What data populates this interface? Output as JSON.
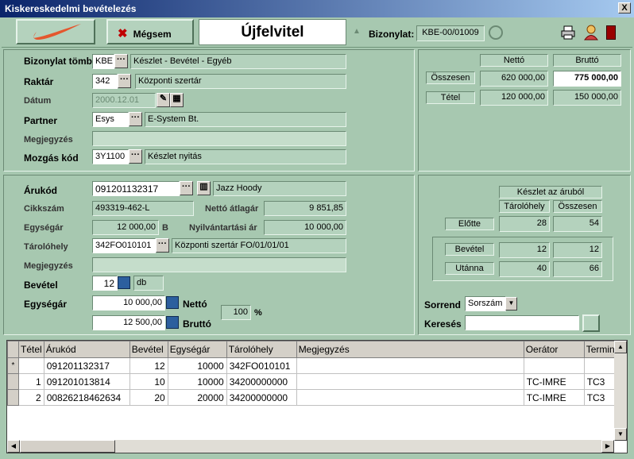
{
  "window": {
    "title": "Kiskereskedelmi bevételezés",
    "close": "X"
  },
  "toolbar": {
    "cancel": "Mégsem",
    "mode": "Újfelvitel",
    "doc_label": "Bizonylat:",
    "doc_value": "KBE-00/01009"
  },
  "form": {
    "bizonylat_tomb_label": "Bizonylat tömb",
    "bizonylat_tomb_code": "KBE",
    "bizonylat_tomb_desc": "Készlet - Bevétel - Egyéb",
    "raktar_label": "Raktár",
    "raktar_code": "342",
    "raktar_desc": "Központi szertár",
    "datum_label": "Dátum",
    "datum_value": "2000.12.01",
    "partner_label": "Partner",
    "partner_code": "Esys",
    "partner_desc": "E-System Bt.",
    "megjegyzes_label": "Megjegyzés",
    "mozgas_label": "Mozgás kód",
    "mozgas_code": "3Y1100",
    "mozgas_desc": "Készlet nyitás"
  },
  "totals": {
    "netto": "Nettó",
    "brutto": "Bruttó",
    "osszesen": "Összesen",
    "osszesen_netto": "620 000,00",
    "osszesen_brutto": "775 000,00",
    "tetel": "Tétel",
    "tetel_netto": "120 000,00",
    "tetel_brutto": "150 000,00"
  },
  "item": {
    "arukod_label": "Árukód",
    "arukod_value": "091201132317",
    "arukod_desc": "Jazz Hoody",
    "cikkszam_label": "Cikkszám",
    "cikkszam_value": "493319-462-L",
    "netto_atlag_label": "Nettó átlagár",
    "netto_atlag_value": "9 851,85",
    "egysegar_label": "Egységár",
    "egysegar_value": "12 000,00",
    "egysegar_unit": "B",
    "nyilvantartasi_label": "Nyilvántartási ár",
    "nyilvantartasi_value": "10 000,00",
    "tarolohely_label": "Tárolóhely",
    "tarolohely_code": "342FO010101",
    "tarolohely_desc": "Központi szertár FO/01/01/01",
    "megjegyzes_label": "Megjegyzés",
    "bevetel_label": "Bevétel",
    "bevetel_value": "12",
    "bevetel_unit": "db",
    "egysegar2_label": "Egységár",
    "netto_value": "10 000,00",
    "netto_label": "Nettó",
    "brutto_value": "12 500,00",
    "brutto_label": "Bruttó",
    "pct_value": "100",
    "pct_unit": "%"
  },
  "stock": {
    "title": "Készlet az áruból",
    "col_taro": "Tárolóhely",
    "col_ossz": "Összesen",
    "elotte": "Előtte",
    "elotte_taro": "28",
    "elotte_ossz": "54",
    "bevetel": "Bevétel",
    "bevetel_taro": "12",
    "bevetel_ossz": "12",
    "utanna": "Utánna",
    "utanna_taro": "40",
    "utanna_ossz": "66"
  },
  "search": {
    "sorrend_label": "Sorrend",
    "sorrend_value": "Sorszám",
    "kereses_label": "Keresés"
  },
  "grid": {
    "headers": [
      "Tétel",
      "Árukód",
      "Bevétel",
      "Egységár",
      "Tárolóhely",
      "Megjegyzés",
      "Oerátor",
      "Termin"
    ],
    "rows": [
      {
        "ind": "*",
        "tetel": "",
        "arukod": "091201132317",
        "bevetel": "12",
        "egysegar": "10000",
        "tarolohely": "342FO010101",
        "megj": "",
        "oper": "",
        "term": ""
      },
      {
        "ind": "",
        "tetel": "1",
        "arukod": "091201013814",
        "bevetel": "10",
        "egysegar": "10000",
        "tarolohely": "34200000000",
        "megj": "",
        "oper": "TC-IMRE",
        "term": "TC3"
      },
      {
        "ind": "",
        "tetel": "2",
        "arukod": "00826218462634",
        "bevetel": "20",
        "egysegar": "20000",
        "tarolohely": "34200000000",
        "megj": "",
        "oper": "TC-IMRE",
        "term": "TC3"
      }
    ]
  }
}
